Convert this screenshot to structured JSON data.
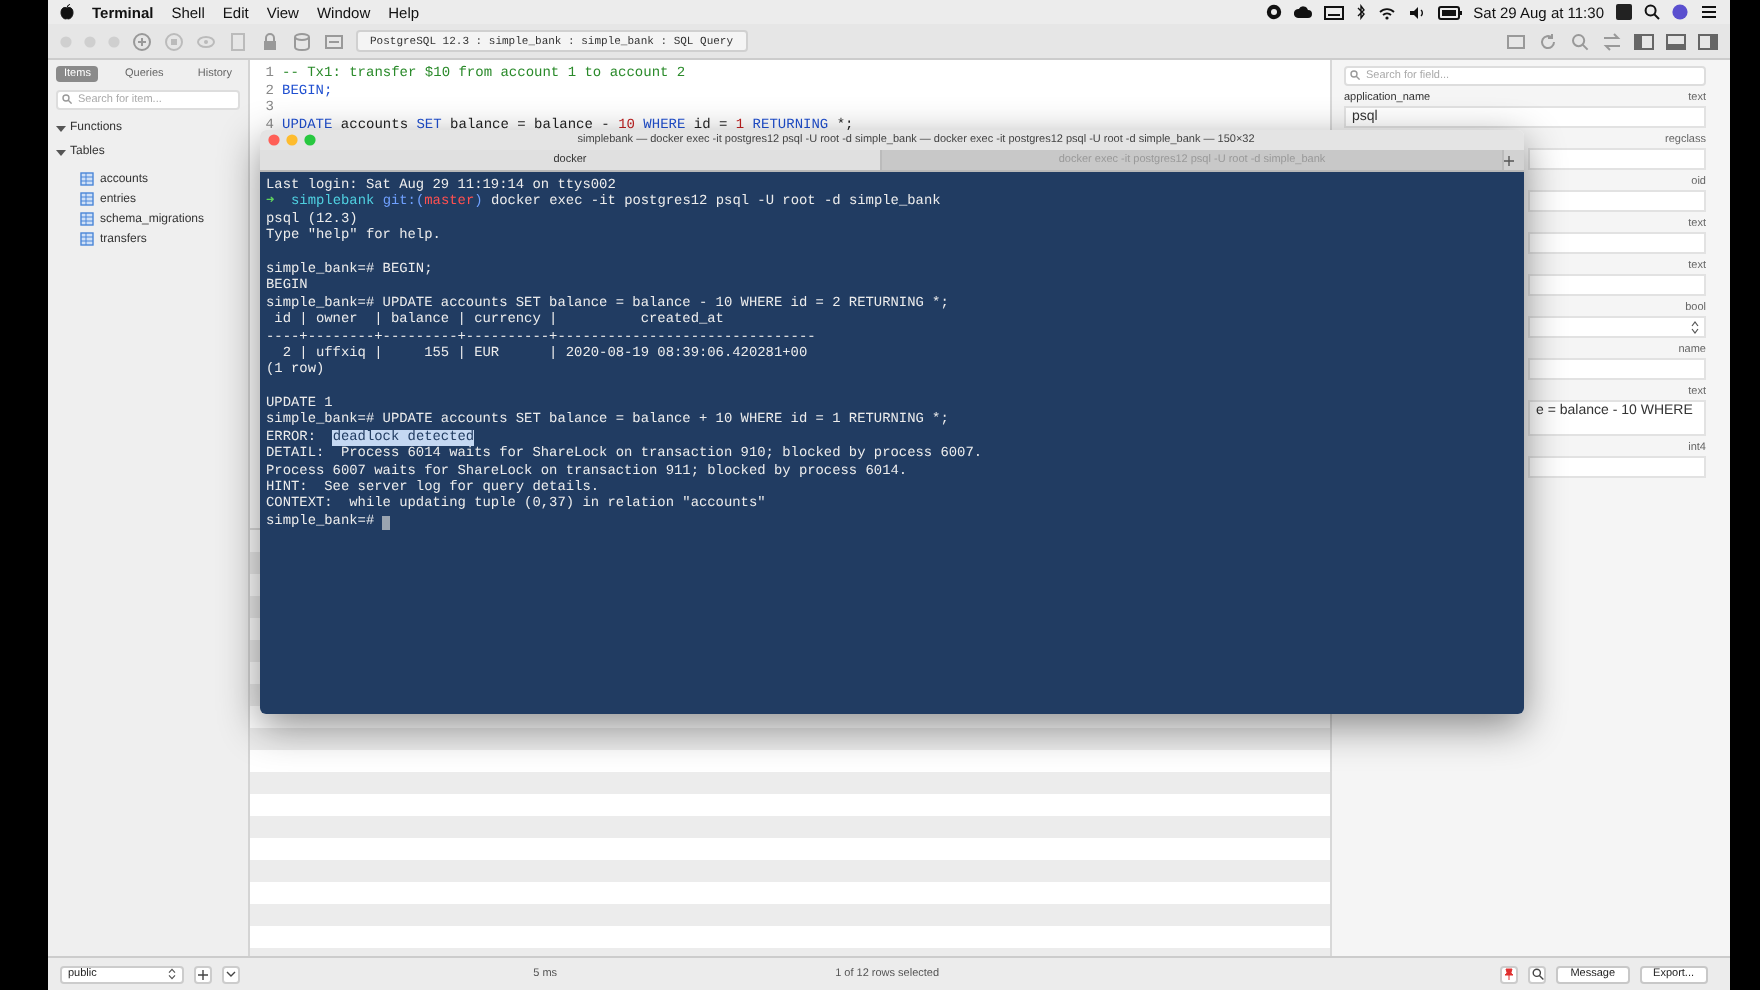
{
  "menu_bar": {
    "app_name": "Terminal",
    "menus": [
      "Shell",
      "Edit",
      "View",
      "Window",
      "Help"
    ],
    "clock": "Sat 29 Aug at 11:30"
  },
  "toolbar": {
    "breadcrumb": "PostgreSQL 12.3 : simple_bank : simple_bank : SQL Query"
  },
  "sidebar": {
    "tabs": [
      {
        "label": "Items",
        "selected": true
      },
      {
        "label": "Queries",
        "selected": false
      },
      {
        "label": "History",
        "selected": false
      }
    ],
    "search": {
      "placeholder": "Search for item..."
    },
    "tree": [
      {
        "label": "Functions",
        "expanded": true
      },
      {
        "label": "Tables",
        "expanded": true,
        "children": [
          {
            "label": "accounts"
          },
          {
            "label": "entries"
          },
          {
            "label": "schema_migrations"
          },
          {
            "label": "transfers"
          }
        ]
      }
    ]
  },
  "editor": {
    "lines": [
      {
        "number": "1",
        "segments": [
          {
            "text": "-- Tx1: transfer $10 from account 1 to account 2",
            "color": "#2a8a2a"
          }
        ]
      },
      {
        "number": "2",
        "segments": [
          {
            "text": "BEGIN;",
            "color": "#1f4fd0"
          }
        ]
      },
      {
        "number": "3"
      },
      {
        "number": "4",
        "segments": [
          {
            "text": "UPDATE",
            "color": "#1f4fd0"
          },
          {
            "text": " accounts ",
            "color": "#222222"
          },
          {
            "text": "SET",
            "color": "#1f4fd0"
          },
          {
            "text": " balance = balance - ",
            "color": "#222222"
          },
          {
            "text": "10",
            "color": "#c02020"
          },
          {
            "text": " WHERE",
            "color": "#1f4fd0"
          },
          {
            "text": " id = ",
            "color": "#222222"
          },
          {
            "text": "1",
            "color": "#c02020"
          },
          {
            "text": " RETURNING",
            "color": "#1f4fd0"
          },
          {
            "text": " *;",
            "color": "#222222"
          }
        ]
      }
    ]
  },
  "field_panel": {
    "search": {
      "placeholder": "Search for field..."
    },
    "fields": [
      {
        "name": "application_name",
        "type": "text",
        "kind": "input",
        "value": "psql"
      },
      {
        "type": "regclass",
        "kind": "input"
      },
      {
        "type": "oid",
        "kind": "input"
      },
      {
        "type": "text",
        "kind": "input"
      },
      {
        "type": "text",
        "kind": "input"
      },
      {
        "type": "bool",
        "kind": "select"
      },
      {
        "type": "name",
        "kind": "input"
      },
      {
        "type": "text",
        "kind": "textarea",
        "value": "e = balance - 10 WHERE"
      },
      {
        "type": "int4",
        "kind": "input"
      }
    ]
  },
  "terminal": {
    "title": "simplebank — docker exec -it postgres12 psql -U root -d simple_bank — docker exec -it postgres12 psql -U root -d simple_bank — 150×32",
    "tabs": [
      {
        "label": "docker",
        "selected": true
      },
      {
        "label": "docker exec -it postgres12 psql -U root -d simple_bank",
        "selected": false
      }
    ],
    "lines": [
      {
        "kind": "text",
        "text": "Last login: Sat Aug 29 11:19:14 on ttys002"
      },
      {
        "kind": "text",
        "segments": [
          {
            "text": "➜",
            "color": "#5fd35f",
            "selected": false
          },
          {
            "text": "  simplebank",
            "color": "#4fd0e0",
            "selected": false
          },
          {
            "text": " git:(",
            "color": "#6fa0ff",
            "selected": false
          },
          {
            "text": "master",
            "color": "#ff5050",
            "selected": false
          },
          {
            "text": ")",
            "color": "#6fa0ff",
            "selected": false
          },
          {
            "text": " docker exec -it postgres12 psql -U root -d simple_bank",
            "color": "#ececec",
            "selected": false
          }
        ]
      },
      {
        "kind": "text",
        "text": "psql (12.3)"
      },
      {
        "kind": "text",
        "text": "Type \"help\" for help."
      },
      {
        "kind": "blank"
      },
      {
        "kind": "text",
        "text": "simple_bank=# BEGIN;"
      },
      {
        "kind": "text",
        "text": "BEGIN"
      },
      {
        "kind": "text",
        "text": "simple_bank=# UPDATE accounts SET balance = balance - 10 WHERE id = 2 RETURNING *;"
      },
      {
        "kind": "text",
        "text": " id | owner  | balance | currency |          created_at"
      },
      {
        "kind": "text",
        "text": "----+--------+---------+----------+-------------------------------"
      },
      {
        "kind": "text",
        "text": "  2 | uffxiq |     155 | EUR      | 2020-08-19 08:39:06.420281+00"
      },
      {
        "kind": "text",
        "text": "(1 row)"
      },
      {
        "kind": "blank"
      },
      {
        "kind": "text",
        "text": "UPDATE 1"
      },
      {
        "kind": "text",
        "text": "simple_bank=# UPDATE accounts SET balance = balance + 10 WHERE id = 1 RETURNING *;"
      },
      {
        "kind": "text",
        "segments": [
          {
            "text": "ERROR:",
            "color": "#ececec",
            "selected": false
          },
          {
            "text": "deadlock detected",
            "color": "#213c62",
            "selected": true
          }
        ]
      },
      {
        "kind": "text",
        "text": "DETAIL:  Process 6014 waits for ShareLock on transaction 910; blocked by process 6007."
      },
      {
        "kind": "text",
        "text": "Process 6007 waits for ShareLock on transaction 911; blocked by process 6014."
      },
      {
        "kind": "text",
        "text": "HINT:  See server log for query details."
      },
      {
        "kind": "text",
        "text": "CONTEXT:  while updating tuple (0,37) in relation \"accounts\""
      },
      {
        "kind": "text",
        "text": "simple_bank=#"
      }
    ],
    "cursor": true
  },
  "status_bar": {
    "schema": "public",
    "timing": "5 ms",
    "selection": "1 of 12 rows selected",
    "buttons": [
      "Message",
      "Export..."
    ]
  }
}
